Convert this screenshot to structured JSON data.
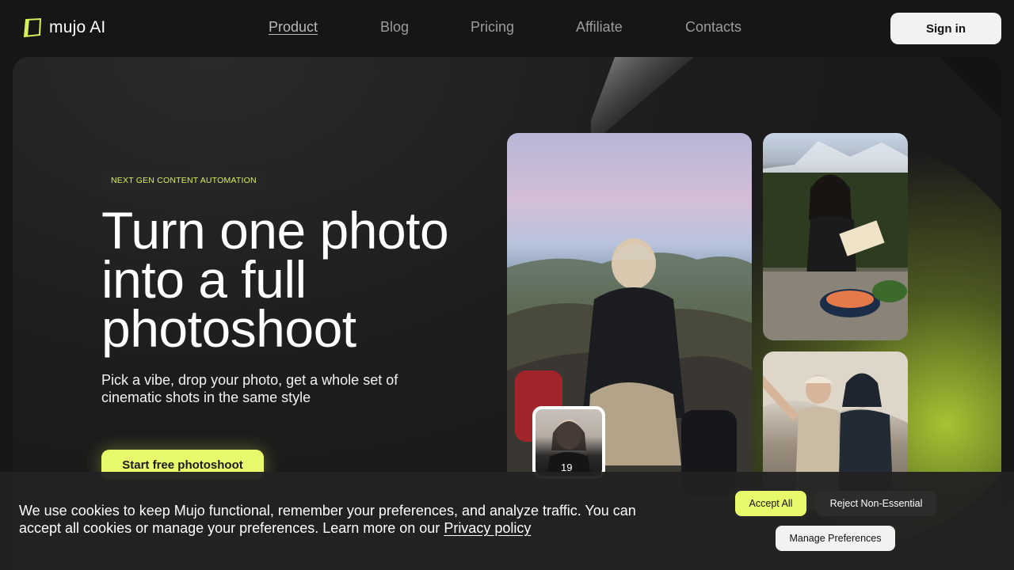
{
  "brand": {
    "name": "mujo AI",
    "accent": "#e8fa6b"
  },
  "nav": {
    "items": [
      {
        "label": "Product",
        "active": true
      },
      {
        "label": "Blog",
        "active": false
      },
      {
        "label": "Pricing",
        "active": false
      },
      {
        "label": "Affiliate",
        "active": false
      },
      {
        "label": "Contacts",
        "active": false
      }
    ],
    "sign_in": "Sign in"
  },
  "hero": {
    "badge": "NEXT GEN CONTENT AUTOMATION",
    "title_line1": "Turn one photo",
    "title_line2": "into a full",
    "title_line3": "photoshoot",
    "subtitle": "Pick a vibe, drop your photo, get a whole set of cinematic shots in the same style",
    "cta": "Start free photoshoot"
  },
  "cookie": {
    "text": "We use cookies to keep Mujo functional, remember your preferences, and analyze traffic. You can accept all cookies or manage your preferences. Learn more on our",
    "link": "Privacy policy",
    "accept": "Accept All",
    "reject": "Reject Non-Essential",
    "manage": "Manage Preferences"
  }
}
